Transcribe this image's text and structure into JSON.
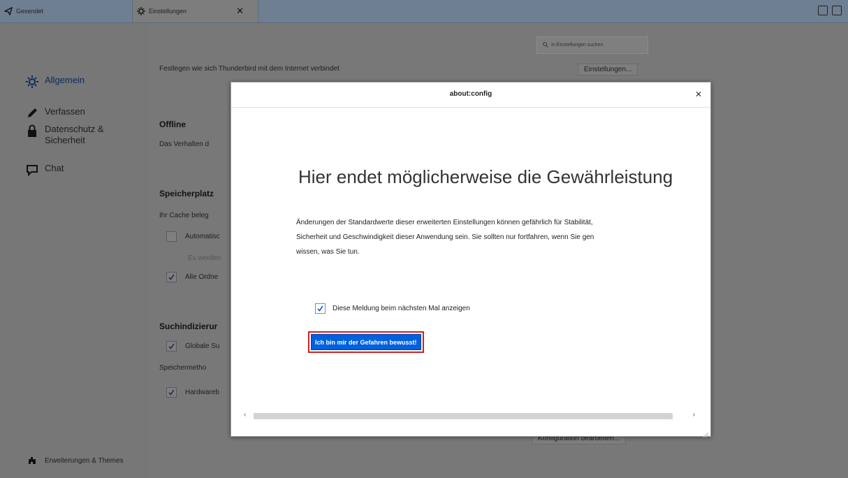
{
  "tabs": [
    {
      "label": "Gesendet",
      "icon": "send-icon",
      "active": false
    },
    {
      "label": "Einstellungen",
      "icon": "gear-icon",
      "active": true
    }
  ],
  "toolbar_right": [
    "calendar-icon",
    "tasks-icon"
  ],
  "sidebar": {
    "items": [
      {
        "label": "Allgemein",
        "icon": "gear-icon",
        "active": true
      },
      {
        "label": "Verfassen",
        "icon": "pencil-icon"
      },
      {
        "label": "Datenschutz & Sicherheit",
        "icon": "lock-icon"
      },
      {
        "label": "Chat",
        "icon": "chat-icon"
      }
    ],
    "footer": {
      "label": "Erweiterungen & Themes",
      "icon": "puzzle-icon"
    }
  },
  "search": {
    "placeholder": "In Einstellungen suchen"
  },
  "background": {
    "network_text": "Festlegen wie sich Thunderbird mit dem Internet verbindet",
    "network_button": "Einstellungen...",
    "offline_heading": "Offline",
    "offline_text": "Das Verhalten d",
    "storage_heading": "Speicherplatz",
    "storage_text": "Ihr Cache beleg",
    "auto_cb": "Automatisc",
    "auto_sub": "Es werden",
    "all_folders_cb": "Alle Ordne",
    "search_heading": "Suchindizierur",
    "global_search_cb": "Globale Su",
    "storage_method": "Speichermetho",
    "hw_cb": "Hardwareb",
    "config_button": "Konfiguration bearbeiten..."
  },
  "dialog": {
    "title": "about:config",
    "warning_title": "Hier endet möglicherweise die Gewährleistung",
    "warning_lines": [
      "Änderungen der Standardwerte dieser erweiterten Einstellungen können gefährlich für Stabilität,",
      "Sicherheit und Geschwindigkeit dieser Anwendung sein. Sie sollten nur fortfahren, wenn Sie gen",
      "wissen, was Sie tun."
    ],
    "checkbox_label": "Diese Meldung beim nächsten Mal anzeigen",
    "checkbox_checked": true,
    "accept_button": "Ich bin mir der Gefahren bewusst!"
  },
  "colors": {
    "accent": "#0060df",
    "highlight": "#d12020",
    "overlay": "#787878"
  }
}
